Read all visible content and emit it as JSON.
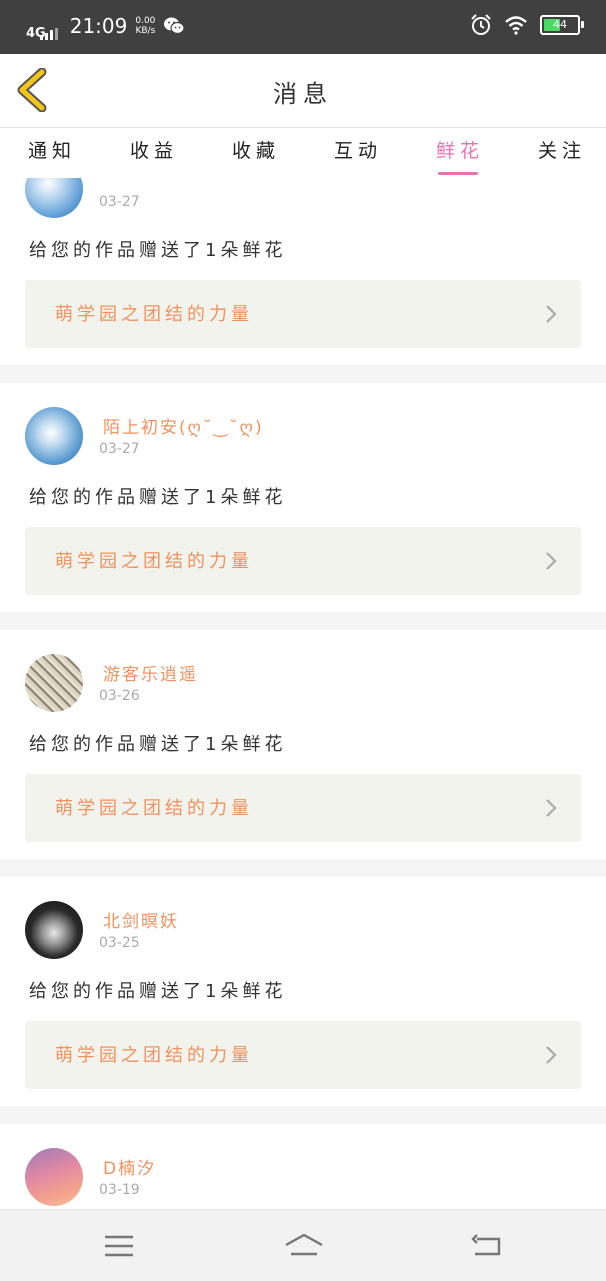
{
  "status_bar": {
    "network": "4G",
    "time": "21:09",
    "speed_value": "0.00",
    "speed_unit": "KB/s",
    "battery_level": "44"
  },
  "header": {
    "title": "消息"
  },
  "tabs": [
    {
      "label": "通知"
    },
    {
      "label": "收益"
    },
    {
      "label": "收藏"
    },
    {
      "label": "互动"
    },
    {
      "label": "鲜花"
    },
    {
      "label": "关注"
    }
  ],
  "active_tab_index": 4,
  "messages": [
    {
      "username": "",
      "date": "03-27",
      "text": "给您的作品赠送了1朵鲜花",
      "work_title": "萌学园之团结的力量"
    },
    {
      "username": "陌上初安(ღ˘‿˘ღ)",
      "date": "03-27",
      "text": "给您的作品赠送了1朵鲜花",
      "work_title": "萌学园之团结的力量"
    },
    {
      "username": "游客乐逍遥",
      "date": "03-26",
      "text": "给您的作品赠送了1朵鲜花",
      "work_title": "萌学园之团结的力量"
    },
    {
      "username": "北剑暝妖",
      "date": "03-25",
      "text": "给您的作品赠送了1朵鲜花",
      "work_title": "萌学园之团结的力量"
    },
    {
      "username": "D楠汐",
      "date": "03-19",
      "text": "",
      "work_title": ""
    }
  ],
  "colors": {
    "accent_pink": "#e973ac",
    "username_orange": "#f0925e",
    "work_card_bg": "#f3f3ee",
    "back_arrow": "#f5c518"
  },
  "icons": {
    "back": "back-arrow-icon",
    "chevron": "chevron-right-icon",
    "nav_menu": "menu-icon",
    "nav_home": "home-icon",
    "nav_back": "return-icon"
  }
}
